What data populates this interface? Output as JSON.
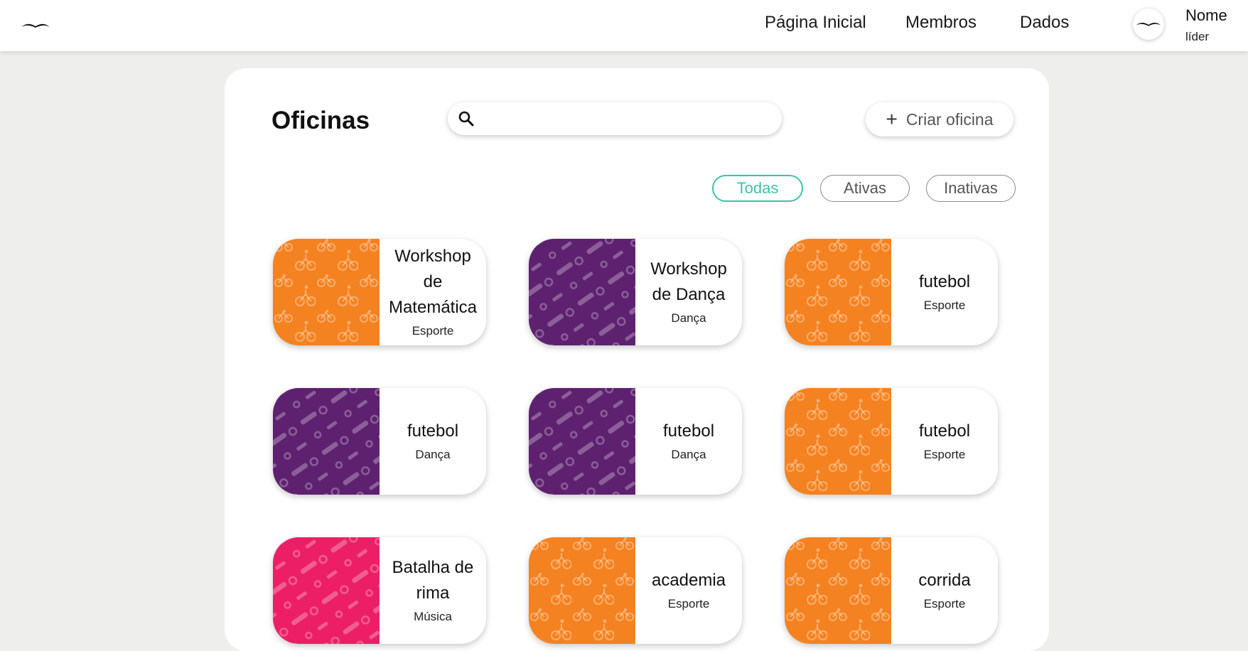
{
  "header": {
    "nav": [
      "Página Inicial",
      "Membros",
      "Dados"
    ],
    "user": {
      "name": "Nome",
      "role": "líder"
    }
  },
  "main": {
    "title": "Oficinas",
    "search": {
      "placeholder": "",
      "value": ""
    },
    "create_label": "Criar oficina",
    "filters": [
      {
        "label": "Todas",
        "active": true
      },
      {
        "label": "Ativas",
        "active": false
      },
      {
        "label": "Inativas",
        "active": false
      }
    ],
    "cards": [
      {
        "title": "Workshop de Matemática",
        "category": "Esporte",
        "color": "#f58220",
        "pattern": "bike"
      },
      {
        "title": "Workshop de Dança",
        "category": "Dança",
        "color": "#5e2170",
        "pattern": "tool"
      },
      {
        "title": "futebol",
        "category": "Esporte",
        "color": "#f58220",
        "pattern": "bike"
      },
      {
        "title": "futebol",
        "category": "Dança",
        "color": "#5e2170",
        "pattern": "tool"
      },
      {
        "title": "futebol",
        "category": "Dança",
        "color": "#5e2170",
        "pattern": "tool"
      },
      {
        "title": "futebol",
        "category": "Esporte",
        "color": "#f58220",
        "pattern": "bike"
      },
      {
        "title": "Batalha de rima",
        "category": "Música",
        "color": "#ec1f66",
        "pattern": "tool"
      },
      {
        "title": "academia",
        "category": "Esporte",
        "color": "#f58220",
        "pattern": "bike"
      },
      {
        "title": "corrida",
        "category": "Esporte",
        "color": "#f58220",
        "pattern": "bike"
      }
    ]
  },
  "colors": {
    "accent": "#3cc3a8",
    "orange": "#f58220",
    "purple": "#5e2170",
    "pink": "#ec1f66"
  },
  "icons": {
    "logo": "bird-logo-icon",
    "search": "search-icon",
    "add": "plus-icon"
  }
}
